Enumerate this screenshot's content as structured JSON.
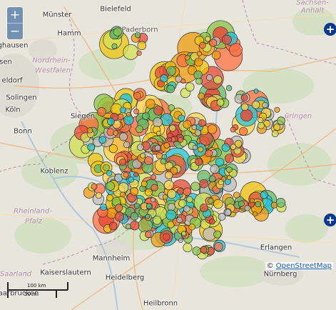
{
  "map": {
    "attribution_symbol": "©",
    "attribution_link": "OpenStreetMap",
    "zoom_in": "+",
    "zoom_out": "−",
    "nav_right_symbol": "+",
    "scale_top": "100 km",
    "scale_bottom": "50 mi",
    "cities": [
      {
        "id": "bielefeld",
        "label": "Bielefeld"
      },
      {
        "id": "munster",
        "label": "Münster"
      },
      {
        "id": "hamm",
        "label": "Hamm"
      },
      {
        "id": "ghausen",
        "label": "ghausen"
      },
      {
        "id": "essen",
        "label": "sen"
      },
      {
        "id": "dusseldorf",
        "label": "eldorf"
      },
      {
        "id": "solingen",
        "label": "Solingen"
      },
      {
        "id": "koln",
        "label": "Köln"
      },
      {
        "id": "siegen",
        "label": "Siegen"
      },
      {
        "id": "bonn",
        "label": "Bonn"
      },
      {
        "id": "koblenz",
        "label": "Koblenz"
      },
      {
        "id": "mannheim",
        "label": "Mannheim"
      },
      {
        "id": "kaiserslautern",
        "label": "Kaiserslautern"
      },
      {
        "id": "heidelberg",
        "label": "Heidelberg"
      },
      {
        "id": "saarbrucken",
        "label": "aarbrücken"
      },
      {
        "id": "heilbronn",
        "label": "Heilbronn"
      },
      {
        "id": "erlangen",
        "label": "Erlangen"
      },
      {
        "id": "nurnberg",
        "label": "Nürnberg"
      },
      {
        "id": "paderborn",
        "label": "Paderborn"
      }
    ],
    "regions": [
      {
        "id": "nrw1",
        "label": "Nordrhein-"
      },
      {
        "id": "nrw2",
        "label": "Westfalen"
      },
      {
        "id": "rp1",
        "label": "Rheinland-"
      },
      {
        "id": "rp2",
        "label": "Pfalz"
      },
      {
        "id": "saar",
        "label": "Saarland"
      },
      {
        "id": "sa1",
        "label": "Sachsen-"
      },
      {
        "id": "sa2",
        "label": "Anhalt"
      },
      {
        "id": "th",
        "label": "üringen"
      }
    ],
    "marker_colors": [
      "#e74c3c",
      "#f39c12",
      "#f1c40f",
      "#d4e157",
      "#8bc34a",
      "#66bb6a",
      "#26c6da",
      "#bdbdbd",
      "#ff7043",
      "#ffd54f"
    ]
  }
}
